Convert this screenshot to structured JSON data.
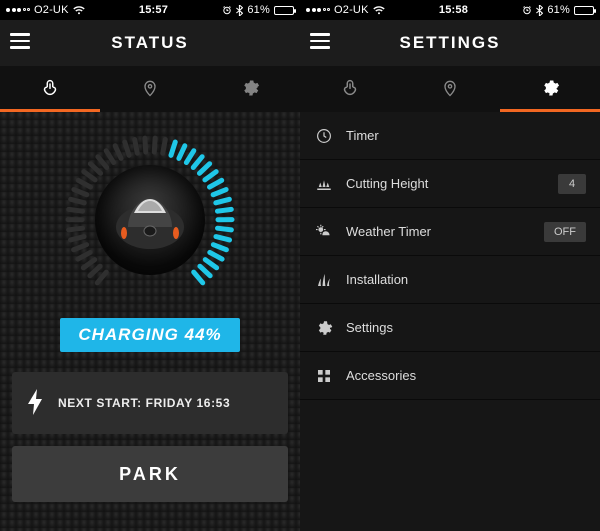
{
  "left": {
    "ios": {
      "carrier": "O2-UK",
      "time": "15:57",
      "battery_pct": "61%",
      "wifi": true,
      "bt": true,
      "alarm": true
    },
    "title": "STATUS",
    "tabs_active_index": 0,
    "charging_label": "CHARGING 44%",
    "charge_fraction": 0.44,
    "next_start": "NEXT START: FRIDAY 16:53",
    "park_label": "PARK"
  },
  "right": {
    "ios": {
      "carrier": "O2-UK",
      "time": "15:58",
      "battery_pct": "61%",
      "wifi": true,
      "bt": true,
      "alarm": true
    },
    "title": "SETTINGS",
    "tabs_active_index": 2,
    "rows": [
      {
        "icon": "clock-icon",
        "label": "Timer",
        "value": null
      },
      {
        "icon": "height-icon",
        "label": "Cutting Height",
        "value": "4"
      },
      {
        "icon": "weather-icon",
        "label": "Weather Timer",
        "value": "OFF"
      },
      {
        "icon": "grass-icon",
        "label": "Installation",
        "value": null
      },
      {
        "icon": "gear-icon",
        "label": "Settings",
        "value": null
      },
      {
        "icon": "grid-icon",
        "label": "Accessories",
        "value": null
      }
    ]
  }
}
